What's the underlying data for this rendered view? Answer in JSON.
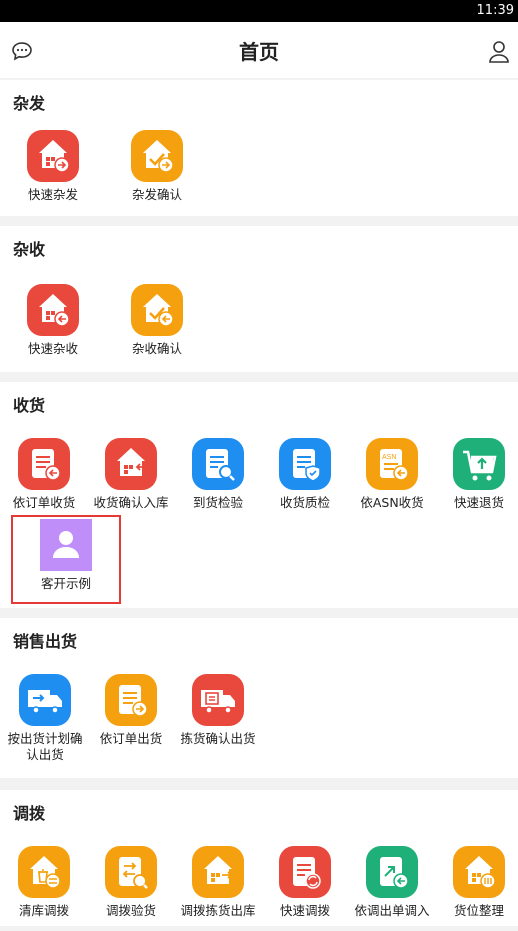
{
  "status": {
    "time": "11:39"
  },
  "header": {
    "title": "首页"
  },
  "sections": {
    "zafa": {
      "title": "杂发",
      "items": [
        {
          "label": "快速杂发",
          "icon": "quick-issue-icon"
        },
        {
          "label": "杂发确认",
          "icon": "issue-confirm-icon"
        }
      ]
    },
    "zashou": {
      "title": "杂收",
      "items": [
        {
          "label": "快速杂收",
          "icon": "quick-receipt-icon"
        },
        {
          "label": "杂收确认",
          "icon": "receipt-confirm-icon"
        }
      ]
    },
    "shouhuo": {
      "title": "收货",
      "items": [
        {
          "label": "依订单收货",
          "icon": "order-receive-icon"
        },
        {
          "label": "收货确认入库",
          "icon": "receive-confirm-icon"
        },
        {
          "label": "到货检验",
          "icon": "arrival-inspect-icon"
        },
        {
          "label": "收货质检",
          "icon": "quality-check-icon"
        },
        {
          "label": "依ASN收货",
          "icon": "asn-receive-icon"
        },
        {
          "label": "快速退货",
          "icon": "quick-return-icon"
        },
        {
          "label": "客开示例",
          "icon": "custom-example-icon"
        }
      ]
    },
    "xiaoshou": {
      "title": "销售出货",
      "items": [
        {
          "label": "按出货计划确认出货",
          "icon": "plan-ship-icon"
        },
        {
          "label": "依订单出货",
          "icon": "order-ship-icon"
        },
        {
          "label": "拣货确认出货",
          "icon": "pick-ship-icon"
        }
      ]
    },
    "diaobo": {
      "title": "调拨",
      "items": [
        {
          "label": "清库调拨",
          "icon": "clear-transfer-icon"
        },
        {
          "label": "调拨验货",
          "icon": "transfer-inspect-icon"
        },
        {
          "label": "调拨拣货出库",
          "icon": "transfer-pick-icon"
        },
        {
          "label": "快速调拨",
          "icon": "quick-transfer-icon"
        },
        {
          "label": "依调出单调入",
          "icon": "transfer-in-icon"
        },
        {
          "label": "货位整理",
          "icon": "location-organize-icon"
        }
      ]
    }
  },
  "colors": {
    "red": "#e9483c",
    "orange": "#f5a00f",
    "blue": "#1e8ef0",
    "green": "#1fb07a",
    "purple": "#c08ef8",
    "highlight": "#e53935"
  }
}
